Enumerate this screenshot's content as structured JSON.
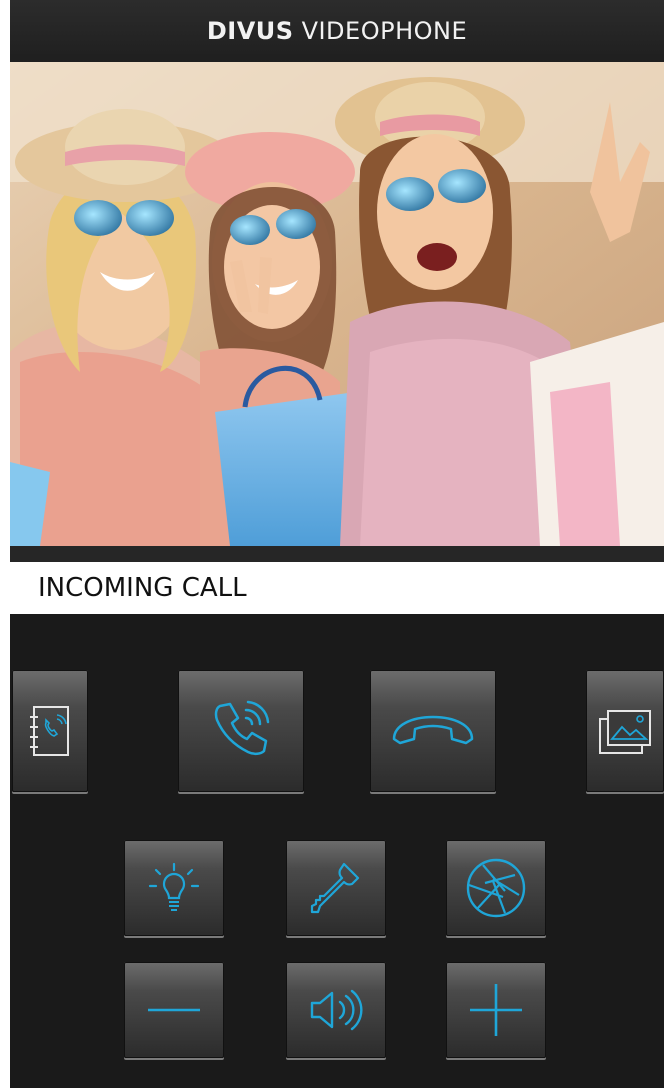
{
  "header": {
    "brand": "DIVUS",
    "product": "VIDEOPHONE"
  },
  "call": {
    "status": "INCOMING CALL"
  },
  "colors": {
    "accent": "#1fa6d8",
    "panel": "#1a1a1a"
  },
  "buttons": {
    "phonebook": "phonebook-icon",
    "answer": "phone-answer-icon",
    "hangup": "phone-hangup-icon",
    "gallery": "gallery-icon",
    "light": "light-bulb-icon",
    "door": "key-icon",
    "snapshot": "camera-shutter-icon",
    "volume_down": "minus-icon",
    "speaker": "speaker-icon",
    "volume_up": "plus-icon"
  }
}
